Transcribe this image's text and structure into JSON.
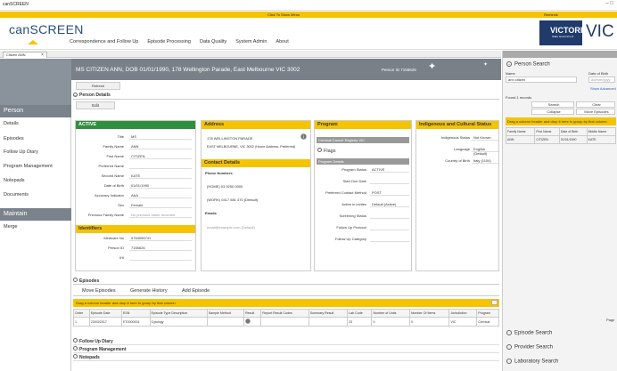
{
  "window": {
    "title": "canSCREEN",
    "controls": "–  □"
  },
  "topbar": {
    "center_text": "Click To Show Menu",
    "right_text": "Reminds"
  },
  "app": {
    "logo": "canSCREEN"
  },
  "nav": [
    "Correspondence and Follow Up",
    "Episode Processing",
    "Data Quality",
    "System Admin",
    "About"
  ],
  "brand": {
    "badge": "VICTORIA",
    "badge_sub": "State Government",
    "text": "VIC"
  },
  "tabs": [
    {
      "label": "Citizen ANN"
    }
  ],
  "sidebar": {
    "person_header": "Person",
    "person_items": [
      "Details",
      "Episodes",
      "Follow Up Diary",
      "Program Management",
      "Notepads",
      "Documents"
    ],
    "maintain_header": "Maintain",
    "maintain_items": [
      "Merge"
    ]
  },
  "banner": {
    "title": "MS CITIZEN ANN, DOB 01/01/1990, 178 Wellington Parade, East Melbourne VIC 3002",
    "person_id": "Person ID 7155626"
  },
  "buttons": {
    "refresh": "Refresh",
    "edit": "Edit"
  },
  "sections": {
    "person_details": "Person Details",
    "episodes": "Episodes",
    "follow_up": "Follow Up Diary",
    "program_mgmt": "Program Management",
    "notepads": "Notepads"
  },
  "status": {
    "header": "ACTIVE",
    "fields": [
      {
        "label": "Title",
        "value": "MS"
      },
      {
        "label": "Family Name",
        "value": "ANN"
      },
      {
        "label": "First Name",
        "value": "CITIZEN"
      },
      {
        "label": "Preferred Name",
        "value": ""
      },
      {
        "label": "Second Name",
        "value": "KATE"
      },
      {
        "label": "Date of Birth",
        "value": "01/01/1990"
      },
      {
        "label": "Accuracy Indicator",
        "value": "AAA"
      },
      {
        "label": "Sex",
        "value": "Female"
      },
      {
        "label": "Previous Family Name",
        "value": "No previous name recorded"
      }
    ]
  },
  "identifiers": {
    "header": "Identifiers",
    "fields": [
      {
        "label": "Medicare No",
        "value": "5763055741"
      },
      {
        "label": "Person ID",
        "value": "7155626"
      },
      {
        "label": "IHI",
        "value": ""
      }
    ]
  },
  "address": {
    "header": "Address",
    "line1": "178 WELLINGTON PARADE",
    "line2": "EAST MELBOURNE, VIC 3002 (Home Address, Preferred)"
  },
  "contact": {
    "header": "Contact Details",
    "phone_label": "Phone Numbers",
    "phone1": "(HOME) 03 9250 0000",
    "phone2": "(WORK) 0417 581 470 (Default)",
    "email_label": "Emails",
    "email": "email@example.com (Default)"
  },
  "program": {
    "header": "Program",
    "registry": "Cervical Cancer Registry VIC",
    "flags": "Flags",
    "details_header": "Program Details",
    "fields": [
      {
        "label": "Program Status",
        "value": "ACTIVE"
      },
      {
        "label": "Start Due Date",
        "value": ""
      },
      {
        "label": "Preferred Contact Method",
        "value": "POST"
      },
      {
        "label": "Active in Invites",
        "value": "Default (Active)"
      },
      {
        "label": "Screening Status",
        "value": ""
      },
      {
        "label": "Follow Up Protocol",
        "value": ""
      },
      {
        "label": "Follow Up Category",
        "value": ""
      }
    ]
  },
  "indigenous": {
    "header": "Indigenous and Cultural Status",
    "fields": [
      {
        "label": "Indigenous Status",
        "value": "Not Known"
      },
      {
        "label": "Language",
        "value": "English (Default)"
      },
      {
        "label": "Country of Birth",
        "value": "Italy (1104)"
      }
    ]
  },
  "episodes": {
    "subtabs": [
      "Move Episodes",
      "Generate History",
      "Add Episode"
    ],
    "group_hint": "Drag a column header and drop it here to group by that column",
    "columns": [
      "Order",
      "Episode Date",
      "ESN",
      "Episode Type Description",
      "Sample Method",
      "Result",
      "Report Result Codes",
      "Summary Result",
      "Lab Code",
      "Number of Units",
      "Number Of Items",
      "Jurisdiction",
      "Program"
    ],
    "rows": [
      [
        "1",
        "23/03/2017",
        "ET0000001",
        "Cytology",
        "",
        "",
        "",
        "",
        "23",
        "0",
        "0",
        "VIC",
        "Cervical"
      ]
    ]
  },
  "right": {
    "search_title": "Person Search",
    "name_label": "Name",
    "name_value": "ann citizen",
    "dob_label": "Date of Birth",
    "dob_value": "dd/mm/yyyy",
    "advanced_link": "Show Advanced",
    "found_label": "Found 1 records",
    "search_btn": "Search",
    "clear_btn": "Clear",
    "collapse_btn": "Collapse",
    "move_btn": "Move Episodes",
    "group_hint": "Drag a column header and drop it here to group by that column",
    "columns": [
      "Family Name",
      "First Name",
      "Date of Birth",
      "Middle Name"
    ],
    "rows": [
      [
        "ANN",
        "CITIZEN",
        "01/01/1990",
        "KATE"
      ]
    ],
    "pager": "Page",
    "episode_search": "Episode Search",
    "provider_search": "Provider Search",
    "laboratory_search": "Laboratory Search"
  }
}
